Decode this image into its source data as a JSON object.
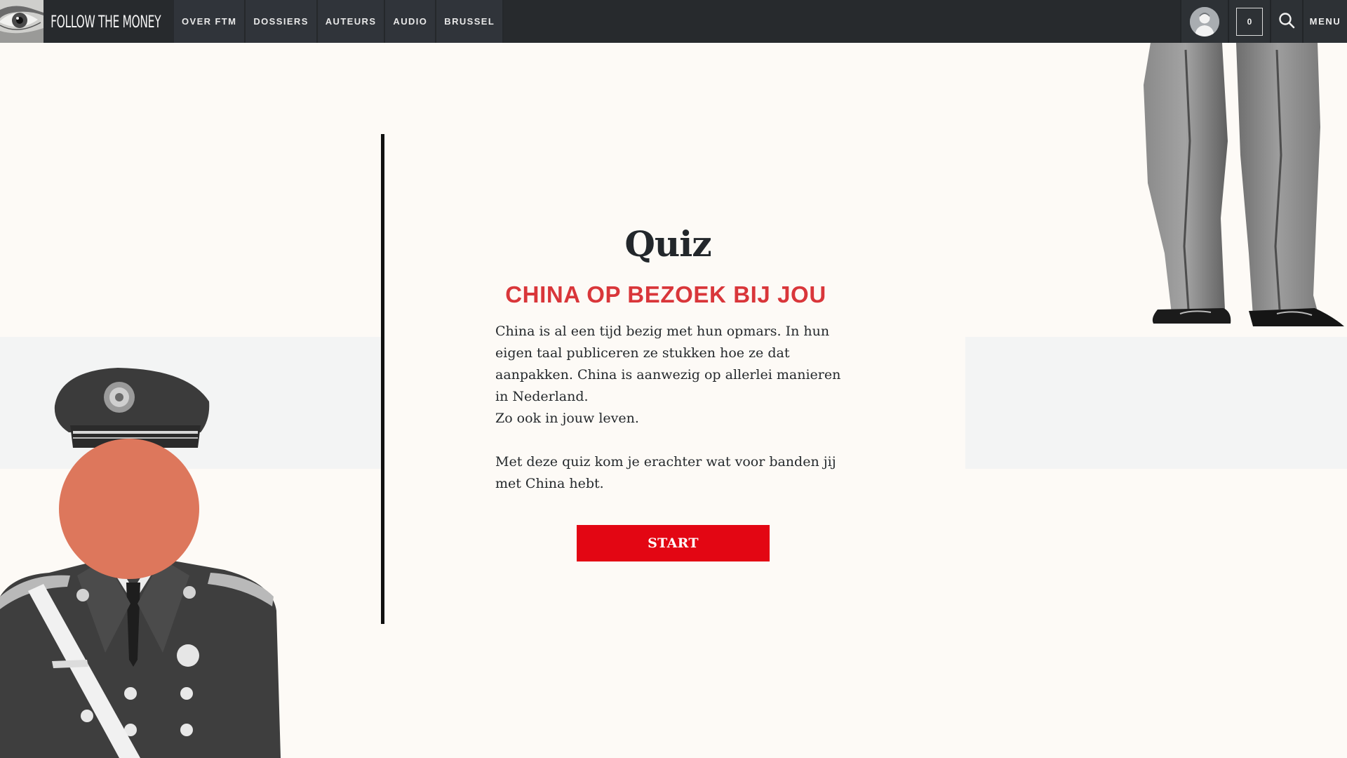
{
  "header": {
    "logo_text": "FOLLOW THE MONEY",
    "nav": [
      {
        "label": "OVER FTM"
      },
      {
        "label": "DOSSIERS"
      },
      {
        "label": "AUTEURS"
      },
      {
        "label": "AUDIO"
      },
      {
        "label": "BRUSSEL"
      }
    ],
    "cart_count": "0",
    "menu_label": "MENU",
    "icons": {
      "logo": "eye-icon",
      "account": "user-avatar-icon",
      "search": "search-icon"
    }
  },
  "main": {
    "title": "Quiz",
    "subtitle": "CHINA OP BEZOEK BIJ JOU",
    "paragraphs": [
      "China is al een tijd bezig met hun opmars. In hun eigen taal publiceren ze stukken hoe ze dat aanpakken. China is aanwezig op allerlei manieren in Nederland.",
      "Zo ook in jouw leven.",
      "Met deze quiz kom je erachter wat voor banden jij met China hebt."
    ],
    "start_label": "START"
  },
  "colors": {
    "header_bg": "#272a2d",
    "page_bg": "#fdfaf6",
    "accent_red": "#e30613",
    "subtitle_red": "#d9363a",
    "circle_orange": "#dd775c"
  }
}
